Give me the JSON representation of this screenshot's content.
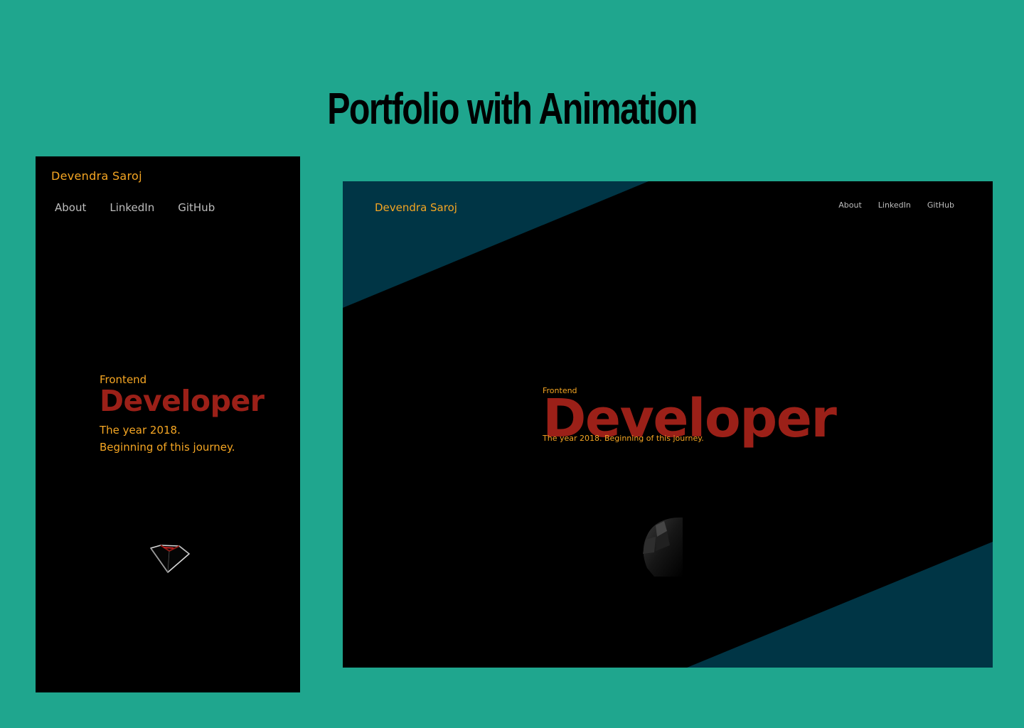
{
  "page": {
    "title": "Portfolio with Animation",
    "background": "#1fa68e"
  },
  "site": {
    "brand": "Devendra Saroj",
    "nav": [
      {
        "label": "About"
      },
      {
        "label": "LinkedIn"
      },
      {
        "label": "GitHub"
      }
    ],
    "hero": {
      "kicker": "Frontend",
      "headline": "Developer",
      "tagline_line1": "The year 2018.",
      "tagline_line2": "Beginning of this journey.",
      "tagline_full": "The year 2018. Beginning of this journey."
    }
  },
  "colors": {
    "accent": "#f5a623",
    "headline": "#9b2018",
    "nav_text": "#bdbdbd",
    "panel": "#000000",
    "stripe": "#003545"
  },
  "icons": {
    "mobile_graphic": "gem-icon",
    "desktop_graphic": "orb-icon"
  }
}
